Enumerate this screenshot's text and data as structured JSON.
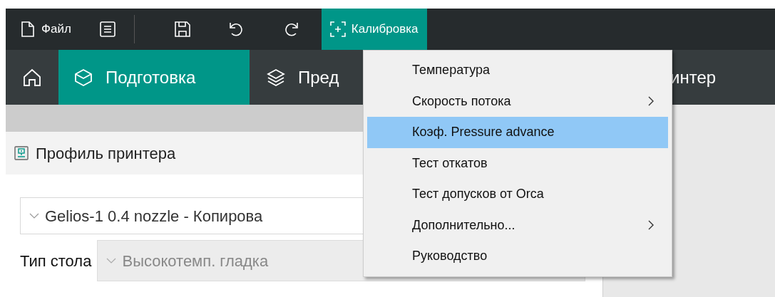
{
  "toolbar": {
    "file_menu": "Файл",
    "calibration_button": {
      "label": "Калибровка",
      "open": true
    }
  },
  "tabs": [
    {
      "kind": "home",
      "selected": false
    },
    {
      "kind": "prepare",
      "label": "Подготовка",
      "selected": true
    },
    {
      "kind": "preview",
      "label": "Пред",
      "selected": false
    },
    {
      "kind": "printer",
      "label": "интер",
      "selected": false
    }
  ],
  "printer_panel": {
    "title": "Профиль принтера",
    "printer_select": "Gelios-1 0.4 nozzle - Копирова",
    "bed_type_label": "Тип стола",
    "bed_type_select": {
      "value": "Высокотемп. гладка",
      "disabled": true
    }
  },
  "calibration_menu": {
    "items": [
      {
        "label": "Температура",
        "has_submenu": false,
        "selected": false
      },
      {
        "label": "Скорость потока",
        "has_submenu": true,
        "selected": false
      },
      {
        "label": "Коэф. Pressure advance",
        "has_submenu": false,
        "selected": true
      },
      {
        "label": "Тест откатов",
        "has_submenu": false,
        "selected": false
      },
      {
        "label": "Тест допусков от Orca",
        "has_submenu": false,
        "selected": false
      },
      {
        "label": "Дополнительно...",
        "has_submenu": true,
        "selected": false
      },
      {
        "label": "Руководство",
        "has_submenu": false,
        "selected": false
      }
    ]
  }
}
